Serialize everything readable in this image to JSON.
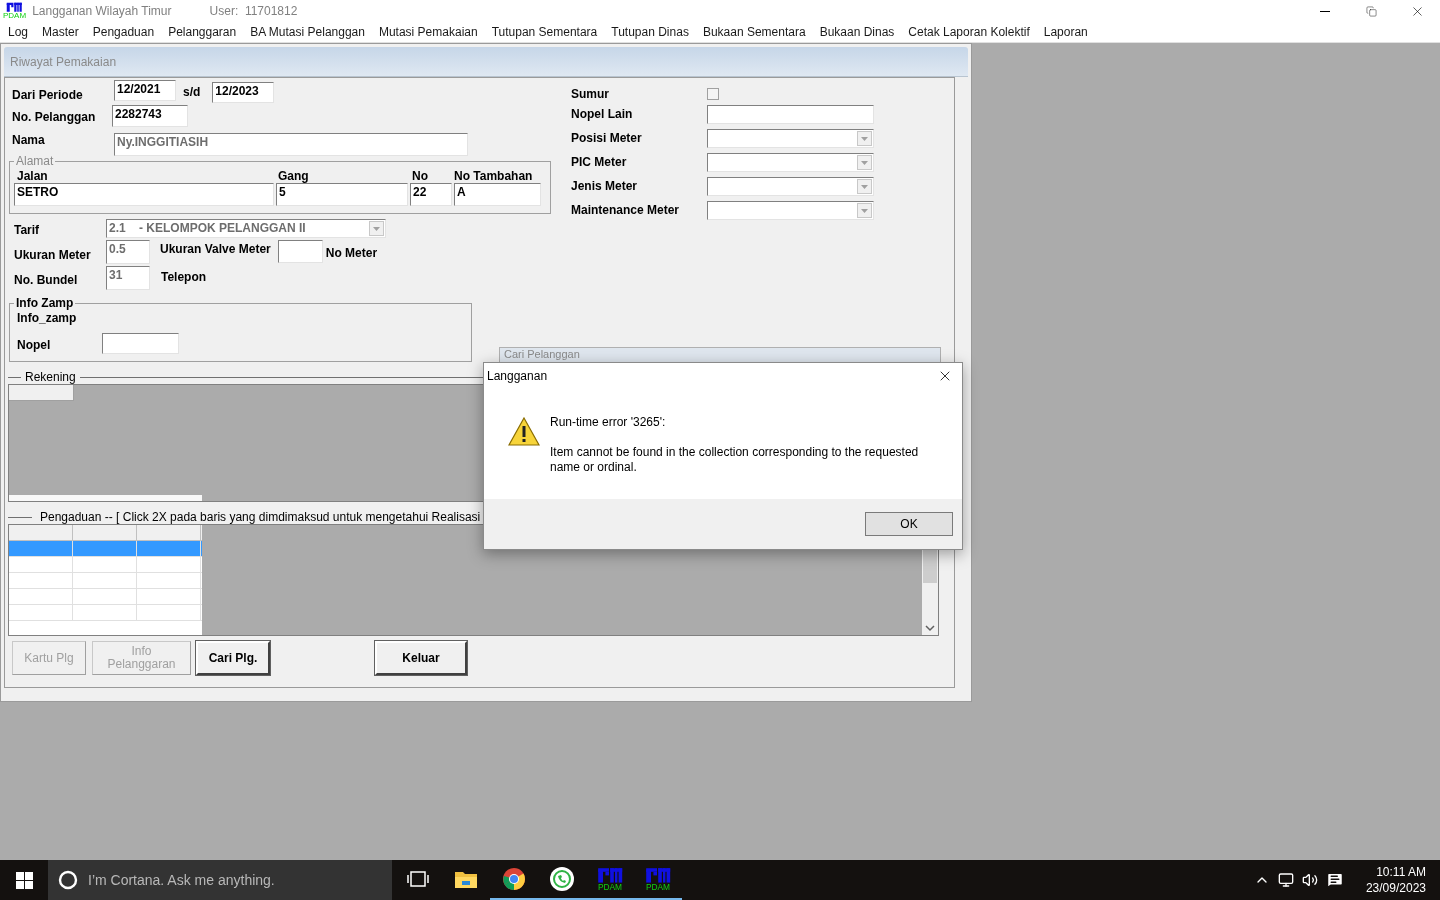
{
  "app": {
    "logo_label": "PDAM",
    "title": "Langganan Wilayah Timur",
    "user": "User:  11701812"
  },
  "menu": [
    "Log",
    "Master",
    "Pengaduan",
    "Pelanggaran",
    "BA Mutasi Pelanggan",
    "Mutasi Pemakaian",
    "Tutupan Sementara",
    "Tutupan Dinas",
    "Bukaan Sementara",
    "Bukaan Dinas",
    "Cetak Laporan Kolektif",
    "Laporan"
  ],
  "form": {
    "title": "Riwayat Pemakaian",
    "periode": {
      "label": "Dari Periode",
      "from": "12/2021",
      "separator": "s/d",
      "to": "12/2023"
    },
    "no_pelanggan": {
      "label": "No. Pelanggan",
      "value": "2282743",
      "disabled": false
    },
    "nama": {
      "label": "Nama",
      "value": "Ny.INGGITIASIH",
      "disabled": true
    },
    "alamat": {
      "title": "Alamat",
      "fields": [
        {
          "label": "Jalan",
          "value": "SETRO"
        },
        {
          "label": "Gang",
          "value": "5"
        },
        {
          "label": "No",
          "value": "22"
        },
        {
          "label": "No Tambahan",
          "value": "A"
        }
      ]
    },
    "tarif": {
      "label": "Tarif",
      "value": "2.1    - KELOMPOK PELANGGAN II",
      "disabled": true
    },
    "ukuran_meter": {
      "label": "Ukuran Meter",
      "value": "0.5",
      "disabled": true
    },
    "ukuran_valve_meter": {
      "label": "Ukuran Valve Meter"
    },
    "no_meter": {
      "label": "No Meter"
    },
    "no_bundel": {
      "label": "No. Bundel",
      "value": "31",
      "disabled": true
    },
    "telepon": {
      "label": "Telepon"
    },
    "info_zamp": {
      "title": "Info Zamp",
      "text": "Info_zamp",
      "nopel_label": "Nopel"
    },
    "right_fields": [
      {
        "kind": "checkbox",
        "label": "Sumur",
        "checked": false
      },
      {
        "kind": "text",
        "label": "Nopel Lain"
      },
      {
        "kind": "combo",
        "label": "Posisi Meter"
      },
      {
        "kind": "combo",
        "label": "PIC Meter"
      },
      {
        "kind": "combo",
        "label": "Jenis Meter"
      },
      {
        "kind": "combo",
        "label": "Maintenance Meter"
      }
    ],
    "rekening": {
      "title": "Rekening"
    },
    "pengaduan": {
      "title": "Pengaduan -- [ Click 2X pada baris yang dimdimaksud untuk mengetahui Realisasi",
      "rows": [
        {
          "selected": true
        },
        {
          "selected": false
        },
        {
          "selected": false
        },
        {
          "selected": false
        },
        {
          "selected": false
        }
      ]
    },
    "buttons": [
      {
        "label": "Kartu Plg",
        "disabled": true
      },
      {
        "label": "Info Pelanggaran",
        "disabled": true
      },
      {
        "label": "Cari Plg.",
        "disabled": false
      },
      {
        "label": "Keluar",
        "disabled": false
      }
    ]
  },
  "background_window": {
    "title": "Cari Pelanggan"
  },
  "dialog": {
    "title": "Langganan",
    "heading": "Run-time error '3265':",
    "message": "Item cannot be found in the collection corresponding to the requested name or ordinal.",
    "button": "OK"
  },
  "taskbar": {
    "search_placeholder": "I’m Cortana. Ask me anything.",
    "apps": [
      {
        "kind": "task-view",
        "running": false
      },
      {
        "kind": "explorer",
        "running": false
      },
      {
        "kind": "chrome",
        "running": true
      },
      {
        "kind": "whatsapp",
        "running": true
      },
      {
        "kind": "pdam",
        "label": "PDAM",
        "running": true
      },
      {
        "kind": "pdam",
        "label": "PDAM",
        "running": true
      }
    ],
    "time": "10:11 AM",
    "date": "23/09/2023"
  }
}
